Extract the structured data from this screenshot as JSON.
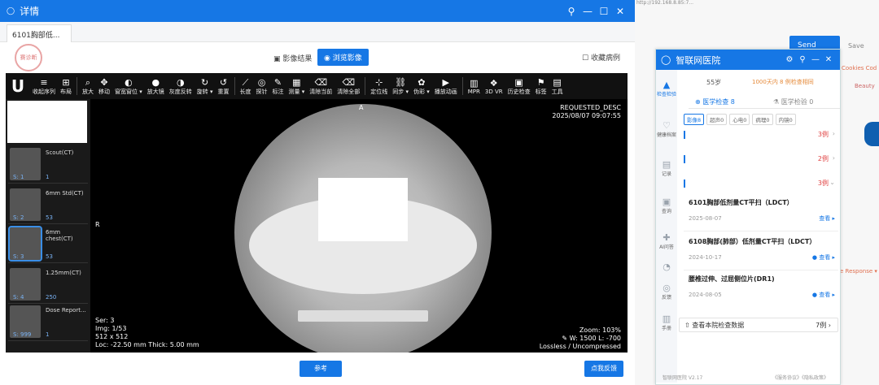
{
  "window": {
    "title": "详情",
    "tab": "6101胸部低..."
  },
  "topbar": {
    "stamp": "赛诊断",
    "seg_result": "影像结果",
    "seg_browse": "浏览影像",
    "collect": "收藏病例"
  },
  "toolbar": {
    "items": [
      {
        "icon": "≡",
        "label": "收起序列"
      },
      {
        "icon": "⊞",
        "label": "布局"
      },
      {
        "icon": "⌕",
        "label": "放大"
      },
      {
        "icon": "✥",
        "label": "移动"
      },
      {
        "icon": "◐",
        "label": "窗宽窗位 ▾"
      },
      {
        "icon": "●",
        "label": "放大镜"
      },
      {
        "icon": "◑",
        "label": "灰度反转"
      },
      {
        "icon": "↻",
        "label": "旋转 ▾"
      },
      {
        "icon": "↺",
        "label": "重置"
      },
      {
        "icon": "⟋",
        "label": "长度"
      },
      {
        "icon": "◎",
        "label": "探针"
      },
      {
        "icon": "✎",
        "label": "标注"
      },
      {
        "icon": "▦",
        "label": "测量 ▾"
      },
      {
        "icon": "⌫",
        "label": "清除当前"
      },
      {
        "icon": "⌫",
        "label": "清除全部"
      },
      {
        "icon": "⊹",
        "label": "定位线"
      },
      {
        "icon": "⛓",
        "label": "同步 ▾"
      },
      {
        "icon": "✿",
        "label": "伪彩 ▾"
      },
      {
        "icon": "▶",
        "label": "播放动画"
      },
      {
        "icon": "▥",
        "label": "MPR"
      },
      {
        "icon": "❖",
        "label": "3D VR"
      },
      {
        "icon": "▣",
        "label": "历史检查"
      },
      {
        "icon": "⚑",
        "label": "标签"
      },
      {
        "icon": "▤",
        "label": "工具"
      }
    ]
  },
  "series": [
    {
      "name": "Scout(CT)",
      "s": "S: 1",
      "count": "1"
    },
    {
      "name": "6mm Std(CT)",
      "s": "S: 2",
      "count": "53"
    },
    {
      "name": "6mm chest(CT)",
      "s": "S: 3",
      "count": "53"
    },
    {
      "name": "1.25mm(CT)",
      "s": "S: 4",
      "count": "250"
    },
    {
      "name": "Dose Report...",
      "s": "S: 999",
      "count": "1"
    }
  ],
  "overlay": {
    "orientation_top": "A",
    "orientation_left": "R",
    "tr1": "REQUESTED_DESC",
    "tr2": "2025/08/07 09:07:55",
    "bl1": "Ser: 3",
    "bl2": "Img: 1/53",
    "bl3": "512 x 512",
    "bl4": "Loc: -22.50 mm Thick: 5.00 mm",
    "br1": "Zoom: 103%",
    "br2": "W: 1500 L: -700",
    "br3": "Lossless / Uncompressed"
  },
  "bottom": {
    "btn_left": "参考",
    "btn_right": "点我反馈"
  },
  "browser": {
    "address": "http://192.168.8.85:7...",
    "send": "Send",
    "save": "Save",
    "cookies": "Cookies  Cod",
    "beauty": "Beauty",
    "response": "e Response ▾"
  },
  "panel": {
    "title": "智联网医院",
    "age": "55岁",
    "warning": "1000天内 8 例检查相同",
    "tabs": [
      "医学检查 8",
      "医学检验 0"
    ],
    "chips": [
      "影像8",
      "超声0",
      "心电0",
      "病理0",
      "内镜0"
    ],
    "nav": [
      "检查检验",
      "健康档案",
      "记录",
      "查询",
      "AI问答",
      "",
      "反馈",
      "手册"
    ],
    "groups": [
      {
        "count": "3例",
        "arrow": "›"
      },
      {
        "count": "2例",
        "arrow": "›"
      },
      {
        "count": "3例",
        "arrow": "⌄"
      }
    ],
    "records": [
      {
        "title": "6101胸部低剂量CT平扫（LDCT）",
        "date": "2025-08-07",
        "view": "查看 ▸"
      },
      {
        "title": "6108胸部(肺部）低剂量CT平扫（LDCT）",
        "date": "2024-10-17",
        "view": "● 查看 ▸"
      },
      {
        "title": "腰椎过伸、过屈侧位片(DR1)",
        "date": "2024-08-05",
        "view": "● 查看 ▸"
      }
    ],
    "footer_left": "查看本院检查数据",
    "footer_right": "7例 ›",
    "version": "智联网医院 V2.17",
    "links": "《服务协议》《隐私政策》"
  }
}
